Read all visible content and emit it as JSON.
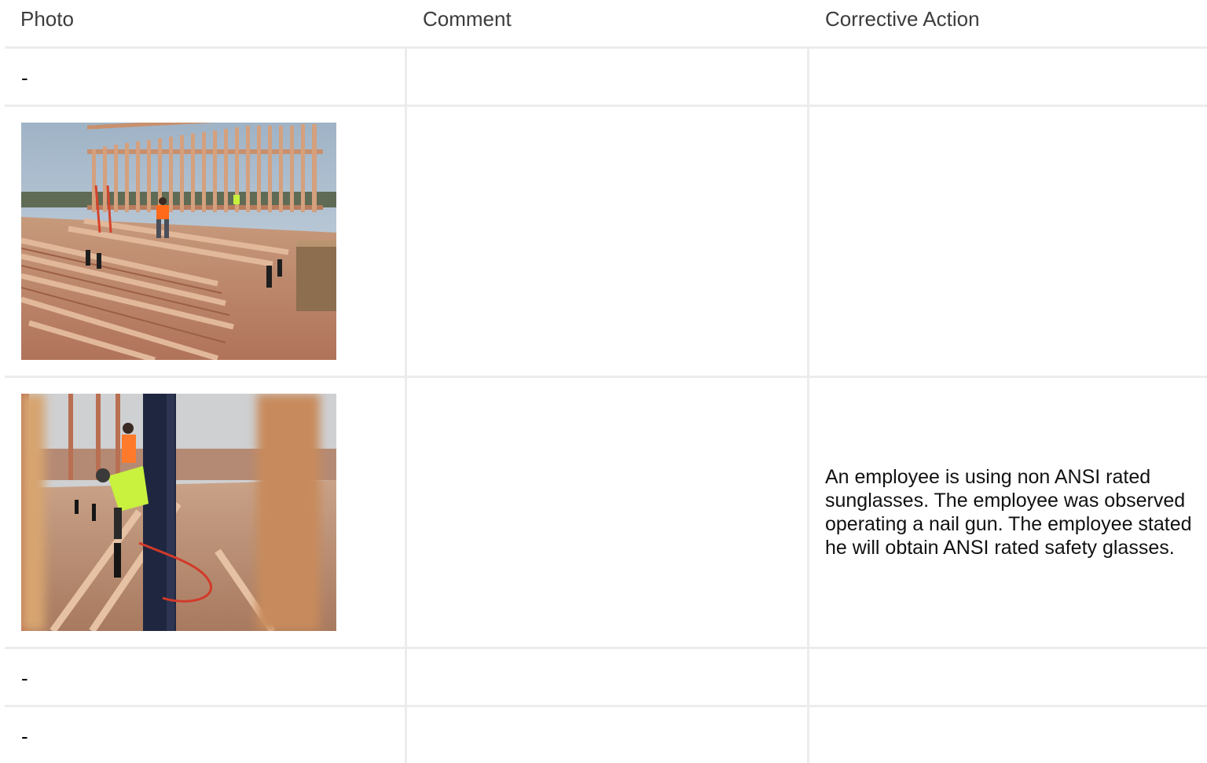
{
  "headers": {
    "photo": "Photo",
    "comment": "Comment",
    "action": "Corrective Action"
  },
  "rows": [
    {
      "photo": "-",
      "comment": "",
      "action": ""
    },
    {
      "photo": "[image: wood wall framing under construction with workers]",
      "comment": "",
      "action": ""
    },
    {
      "photo": "[image: worker in high-visibility shirt operating a nail gun, partially blurred]",
      "comment": "",
      "action": "An employee is using non ANSI rated sunglasses. The employee was observed operating a nail gun. The employee stated he will obtain ANSI rated safety glasses."
    },
    {
      "photo": "-",
      "comment": "",
      "action": ""
    },
    {
      "photo": "-",
      "comment": "",
      "action": ""
    }
  ],
  "colors": {
    "border": "#ececec",
    "header_text": "#3c3c3c"
  }
}
